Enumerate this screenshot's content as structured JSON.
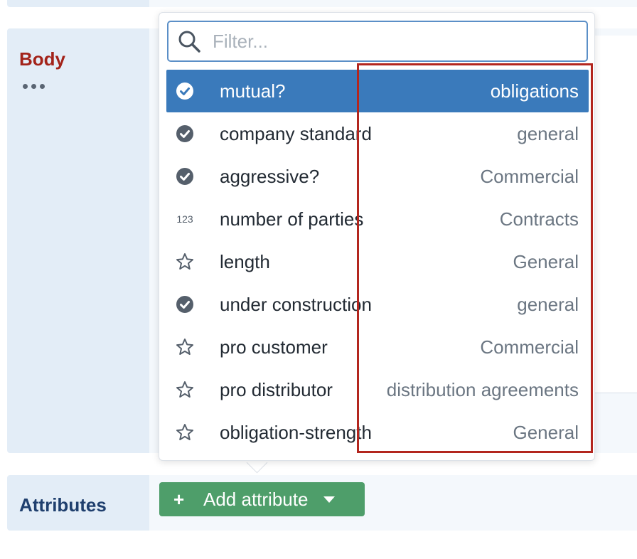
{
  "sections": {
    "body_label": "Body",
    "attributes_label": "Attributes"
  },
  "add_button": {
    "plus": "+",
    "label": "Add attribute"
  },
  "popover": {
    "filter_placeholder": "Filter...",
    "items": [
      {
        "icon": "check-circle-icon",
        "name": "mutual?",
        "category": "obligations",
        "selected": true
      },
      {
        "icon": "check-circle-icon",
        "name": "company standard",
        "category": "general"
      },
      {
        "icon": "check-circle-icon",
        "name": "aggressive?",
        "category": "Commercial"
      },
      {
        "icon": "number-icon",
        "icon_text": "123",
        "name": "number of parties",
        "category": "Contracts"
      },
      {
        "icon": "star-icon",
        "name": "length",
        "category": "General"
      },
      {
        "icon": "check-circle-icon",
        "name": "under construction",
        "category": "general"
      },
      {
        "icon": "star-icon",
        "name": "pro customer",
        "category": "Commercial"
      },
      {
        "icon": "star-icon",
        "name": "pro distributor",
        "category": "distribution agreements"
      },
      {
        "icon": "star-icon",
        "name": "obligation-strength",
        "category": "General"
      }
    ]
  },
  "colors": {
    "selected_row": "#3a7abb",
    "add_button": "#4e9e6a",
    "body_label": "#a3231a",
    "attributes_label": "#1f3f6e",
    "highlight_box": "#b3261e"
  }
}
